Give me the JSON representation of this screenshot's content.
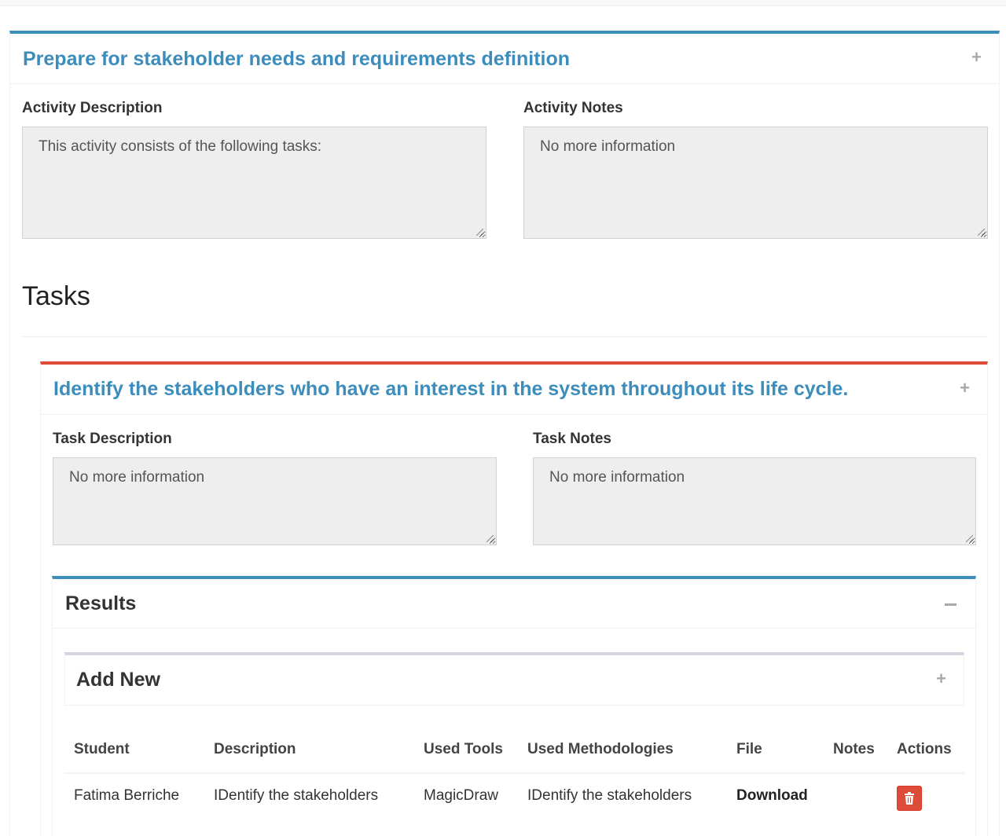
{
  "activity": {
    "title": "Prepare for stakeholder needs and requirements definition",
    "expand_icon": "plus-icon",
    "description_label": "Activity Description",
    "description_value": "This activity consists of the following tasks:",
    "notes_label": "Activity Notes",
    "notes_value": "No more information"
  },
  "tasks_heading": "Tasks",
  "task": {
    "title": "Identify the stakeholders who have an interest in the system throughout its life cycle.",
    "expand_icon": "plus-icon",
    "description_label": "Task Description",
    "description_value": "No more information",
    "notes_label": "Task Notes",
    "notes_value": "No more information"
  },
  "results": {
    "title": "Results",
    "collapse_icon": "minus-icon",
    "add_new": {
      "title": "Add New",
      "expand_icon": "plus-icon"
    },
    "columns": [
      "Student",
      "Description",
      "Used Tools",
      "Used Methodologies",
      "File",
      "Notes",
      "Actions"
    ],
    "rows": [
      {
        "student": "Fatima Berriche",
        "description": "IDentify the stakeholders",
        "used_tools": "MagicDraw",
        "used_methodologies": "IDentify the stakeholders",
        "file": "Download",
        "notes": "",
        "action_icon": "trash-icon"
      }
    ]
  },
  "colors": {
    "primary_border": "#3c8dbc",
    "danger_border": "#dd4b39",
    "default_border": "#d2d6de",
    "title_blue": "#3c8dbc",
    "danger_button": "#dd4b39"
  }
}
